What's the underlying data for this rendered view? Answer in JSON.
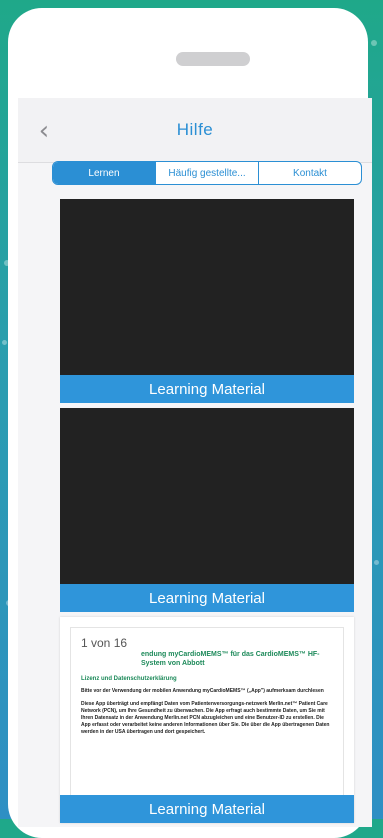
{
  "navbar": {
    "title": "Hilfe",
    "back_icon": "chevron-left-icon"
  },
  "tabs": [
    {
      "label": "Lernen",
      "active": true
    },
    {
      "label": "Häufig gestellte...",
      "active": false
    },
    {
      "label": "Kontakt",
      "active": false
    }
  ],
  "cards": [
    {
      "label": "Learning Material"
    },
    {
      "label": "Learning Material"
    },
    {
      "label": "Learning Material"
    }
  ],
  "document_preview": {
    "page_indicator": "1 von 16",
    "heading": "endung myCardioMEMS™ für das CardioMEMS™ HF-System von Abbott",
    "subheading": "Lizenz und Datenschutzerklärung",
    "paragraph1": "Bitte vor der Verwendung der mobilen Anwendung myCardioMEMS™ („App\") aufmerksam durchlesen",
    "paragraph2": "Diese App überträgt und empfängt Daten vom Patientenversorgungs-netzwerk Merlin.net™ Patient Care Network (PCN), um Ihre Gesundheit zu überwachen. Die App erfragt auch bestimmte Daten, um Sie mit Ihren Datensatz in der Anwendung Merlin.net PCN abzugleichen und eine Benutzer-ID zu erstellen. Die App erfasst oder verarbeitet keine anderen Informationen über Sie. Die über die App übertragenen Daten werden in der USA übertragen und dort gespeichert."
  },
  "colors": {
    "accent": "#2b8fd4",
    "video_bg": "#222222",
    "label_bg": "#2f95da"
  }
}
